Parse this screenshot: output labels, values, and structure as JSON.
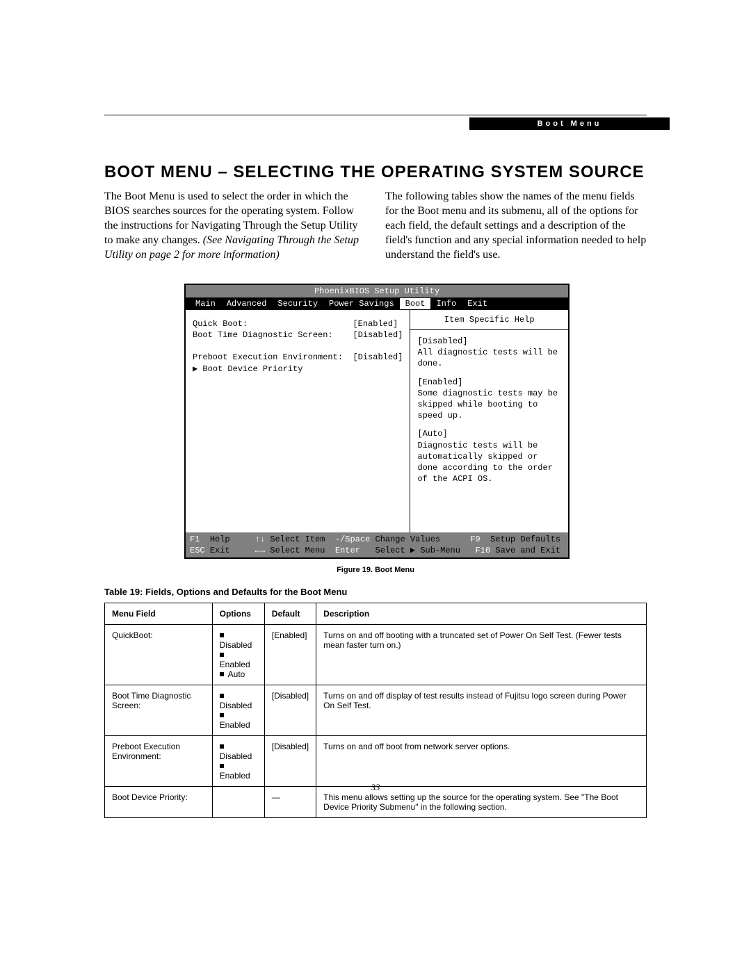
{
  "header_tab": "Boot Menu",
  "title": "BOOT MENU – SELECTING THE OPERATING SYSTEM SOURCE",
  "para_left_1": "The Boot Menu is used to select the order in which the BIOS searches sources for the operating system. Follow the instructions for Navigating Through the Setup Utility to make any changes. ",
  "para_left_ital": "(See Navigating Through the Setup Utility on page 2 for more information)",
  "para_right": "The following tables show the names of the menu fields for the Boot menu and its submenu, all of the options for each field, the default settings and a description of the field's function and any special information needed to help understand the field's use.",
  "bios": {
    "title": "PhoenixBIOS Setup Utility",
    "tabs": [
      "Main",
      "Advanced",
      "Security",
      "Power Savings",
      "Boot",
      "Info",
      "Exit"
    ],
    "selected_tab": "Boot",
    "left_items": [
      {
        "label": "Quick Boot:",
        "value": "[Enabled]"
      },
      {
        "label": "Boot Time Diagnostic Screen:",
        "value": "[Disabled]"
      },
      {
        "label": "",
        "value": ""
      },
      {
        "label": "Preboot Execution Environment:",
        "value": "[Disabled]"
      },
      {
        "label": "▶ Boot Device Priority",
        "value": ""
      }
    ],
    "help_title": "Item Specific Help",
    "help": [
      "[Disabled]\nAll diagnostic tests will be done.",
      "[Enabled]\nSome diagnostic tests may be skipped while booting to speed up.",
      "[Auto]\nDiagnostic tests will be automatically skipped or done according to the order of the ACPI OS."
    ],
    "footer": {
      "f1": "F1",
      "help": "Help",
      "updn": "↑↓",
      "sel_item": "Select Item",
      "chg_key": "-/Space",
      "chg": "Change Values",
      "f9": "F9",
      "setdef": "Setup Defaults",
      "esc": "ESC",
      "exit": "Exit",
      "lr": "←→",
      "sel_menu": "Select Menu",
      "enter": "Enter",
      "sub": "Select ▶ Sub-Menu",
      "f10": "F10",
      "save": "Save and Exit"
    }
  },
  "figure_caption": "Figure 19.   Boot Menu",
  "table_title": "Table 19: Fields, Options and Defaults for the Boot Menu",
  "table_headers": [
    "Menu Field",
    "Options",
    "Default",
    "Description"
  ],
  "table_rows": [
    {
      "field": "QuickBoot:",
      "options": [
        "Disabled",
        "Enabled",
        "Auto"
      ],
      "default": "[Enabled]",
      "desc": "Turns on and off booting with a truncated set of Power On Self Test. (Fewer tests mean faster turn on.)"
    },
    {
      "field": "Boot Time Diagnostic Screen:",
      "options": [
        "Disabled",
        "Enabled"
      ],
      "default": "[Disabled]",
      "desc": "Turns on and off display of test results instead of Fujitsu logo screen during Power On Self Test."
    },
    {
      "field": "Preboot Execution Environment:",
      "options": [
        "Disabled",
        "Enabled"
      ],
      "default": "[Disabled]",
      "desc": "Turns on and off boot from network server options."
    },
    {
      "field": "Boot Device Priority:",
      "options": [],
      "default": "—",
      "desc": "This menu allows setting up the source for the operating system. See \"The Boot Device Priority Submenu\" in the following section."
    }
  ],
  "page_number": "33"
}
